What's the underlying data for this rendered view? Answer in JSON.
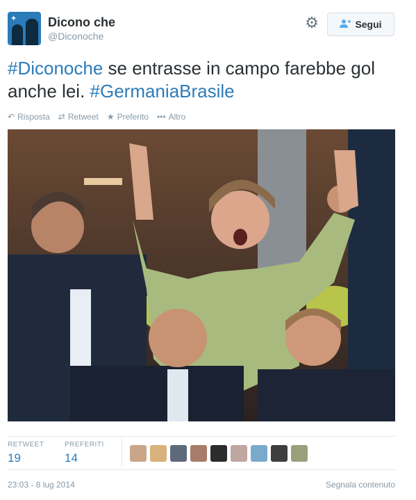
{
  "user": {
    "name": "Dicono che",
    "handle": "@Diconoche",
    "follow_label": "Segui"
  },
  "tweet": {
    "hashtag1": "#Diconoche",
    "text_middle": " se entrasse in campo farebbe gol anche lei. ",
    "hashtag2": "#GermaniaBrasile"
  },
  "actions": {
    "reply": "Risposta",
    "retweet": "Retweet",
    "favorite": "Preferito",
    "more": "Altro"
  },
  "stats": {
    "retweet_label": "RETWEET",
    "retweet_count": "19",
    "fav_label": "PREFERITI",
    "fav_count": "14"
  },
  "footer": {
    "timestamp": "23:03 - 8 lug 2014",
    "report": "Segnala contenuto"
  },
  "colors": {
    "link": "#2b7bb9",
    "muted": "#8899a6",
    "text": "#292f33"
  }
}
